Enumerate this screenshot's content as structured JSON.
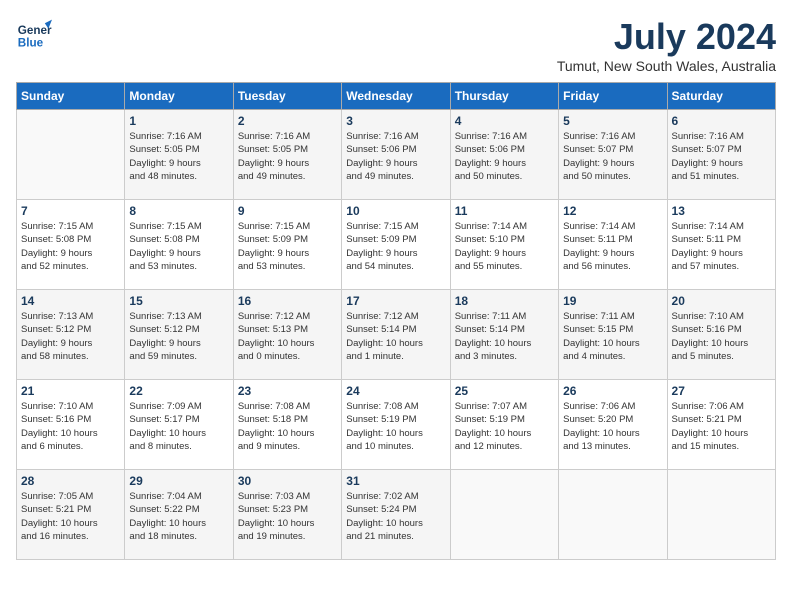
{
  "logo": {
    "line1": "General",
    "line2": "Blue"
  },
  "title": "July 2024",
  "subtitle": "Tumut, New South Wales, Australia",
  "days_of_week": [
    "Sunday",
    "Monday",
    "Tuesday",
    "Wednesday",
    "Thursday",
    "Friday",
    "Saturday"
  ],
  "weeks": [
    [
      {
        "day": "",
        "info": ""
      },
      {
        "day": "1",
        "info": "Sunrise: 7:16 AM\nSunset: 5:05 PM\nDaylight: 9 hours\nand 48 minutes."
      },
      {
        "day": "2",
        "info": "Sunrise: 7:16 AM\nSunset: 5:05 PM\nDaylight: 9 hours\nand 49 minutes."
      },
      {
        "day": "3",
        "info": "Sunrise: 7:16 AM\nSunset: 5:06 PM\nDaylight: 9 hours\nand 49 minutes."
      },
      {
        "day": "4",
        "info": "Sunrise: 7:16 AM\nSunset: 5:06 PM\nDaylight: 9 hours\nand 50 minutes."
      },
      {
        "day": "5",
        "info": "Sunrise: 7:16 AM\nSunset: 5:07 PM\nDaylight: 9 hours\nand 50 minutes."
      },
      {
        "day": "6",
        "info": "Sunrise: 7:16 AM\nSunset: 5:07 PM\nDaylight: 9 hours\nand 51 minutes."
      }
    ],
    [
      {
        "day": "7",
        "info": "Sunrise: 7:15 AM\nSunset: 5:08 PM\nDaylight: 9 hours\nand 52 minutes."
      },
      {
        "day": "8",
        "info": "Sunrise: 7:15 AM\nSunset: 5:08 PM\nDaylight: 9 hours\nand 53 minutes."
      },
      {
        "day": "9",
        "info": "Sunrise: 7:15 AM\nSunset: 5:09 PM\nDaylight: 9 hours\nand 53 minutes."
      },
      {
        "day": "10",
        "info": "Sunrise: 7:15 AM\nSunset: 5:09 PM\nDaylight: 9 hours\nand 54 minutes."
      },
      {
        "day": "11",
        "info": "Sunrise: 7:14 AM\nSunset: 5:10 PM\nDaylight: 9 hours\nand 55 minutes."
      },
      {
        "day": "12",
        "info": "Sunrise: 7:14 AM\nSunset: 5:11 PM\nDaylight: 9 hours\nand 56 minutes."
      },
      {
        "day": "13",
        "info": "Sunrise: 7:14 AM\nSunset: 5:11 PM\nDaylight: 9 hours\nand 57 minutes."
      }
    ],
    [
      {
        "day": "14",
        "info": "Sunrise: 7:13 AM\nSunset: 5:12 PM\nDaylight: 9 hours\nand 58 minutes."
      },
      {
        "day": "15",
        "info": "Sunrise: 7:13 AM\nSunset: 5:12 PM\nDaylight: 9 hours\nand 59 minutes."
      },
      {
        "day": "16",
        "info": "Sunrise: 7:12 AM\nSunset: 5:13 PM\nDaylight: 10 hours\nand 0 minutes."
      },
      {
        "day": "17",
        "info": "Sunrise: 7:12 AM\nSunset: 5:14 PM\nDaylight: 10 hours\nand 1 minute."
      },
      {
        "day": "18",
        "info": "Sunrise: 7:11 AM\nSunset: 5:14 PM\nDaylight: 10 hours\nand 3 minutes."
      },
      {
        "day": "19",
        "info": "Sunrise: 7:11 AM\nSunset: 5:15 PM\nDaylight: 10 hours\nand 4 minutes."
      },
      {
        "day": "20",
        "info": "Sunrise: 7:10 AM\nSunset: 5:16 PM\nDaylight: 10 hours\nand 5 minutes."
      }
    ],
    [
      {
        "day": "21",
        "info": "Sunrise: 7:10 AM\nSunset: 5:16 PM\nDaylight: 10 hours\nand 6 minutes."
      },
      {
        "day": "22",
        "info": "Sunrise: 7:09 AM\nSunset: 5:17 PM\nDaylight: 10 hours\nand 8 minutes."
      },
      {
        "day": "23",
        "info": "Sunrise: 7:08 AM\nSunset: 5:18 PM\nDaylight: 10 hours\nand 9 minutes."
      },
      {
        "day": "24",
        "info": "Sunrise: 7:08 AM\nSunset: 5:19 PM\nDaylight: 10 hours\nand 10 minutes."
      },
      {
        "day": "25",
        "info": "Sunrise: 7:07 AM\nSunset: 5:19 PM\nDaylight: 10 hours\nand 12 minutes."
      },
      {
        "day": "26",
        "info": "Sunrise: 7:06 AM\nSunset: 5:20 PM\nDaylight: 10 hours\nand 13 minutes."
      },
      {
        "day": "27",
        "info": "Sunrise: 7:06 AM\nSunset: 5:21 PM\nDaylight: 10 hours\nand 15 minutes."
      }
    ],
    [
      {
        "day": "28",
        "info": "Sunrise: 7:05 AM\nSunset: 5:21 PM\nDaylight: 10 hours\nand 16 minutes."
      },
      {
        "day": "29",
        "info": "Sunrise: 7:04 AM\nSunset: 5:22 PM\nDaylight: 10 hours\nand 18 minutes."
      },
      {
        "day": "30",
        "info": "Sunrise: 7:03 AM\nSunset: 5:23 PM\nDaylight: 10 hours\nand 19 minutes."
      },
      {
        "day": "31",
        "info": "Sunrise: 7:02 AM\nSunset: 5:24 PM\nDaylight: 10 hours\nand 21 minutes."
      },
      {
        "day": "",
        "info": ""
      },
      {
        "day": "",
        "info": ""
      },
      {
        "day": "",
        "info": ""
      }
    ]
  ]
}
